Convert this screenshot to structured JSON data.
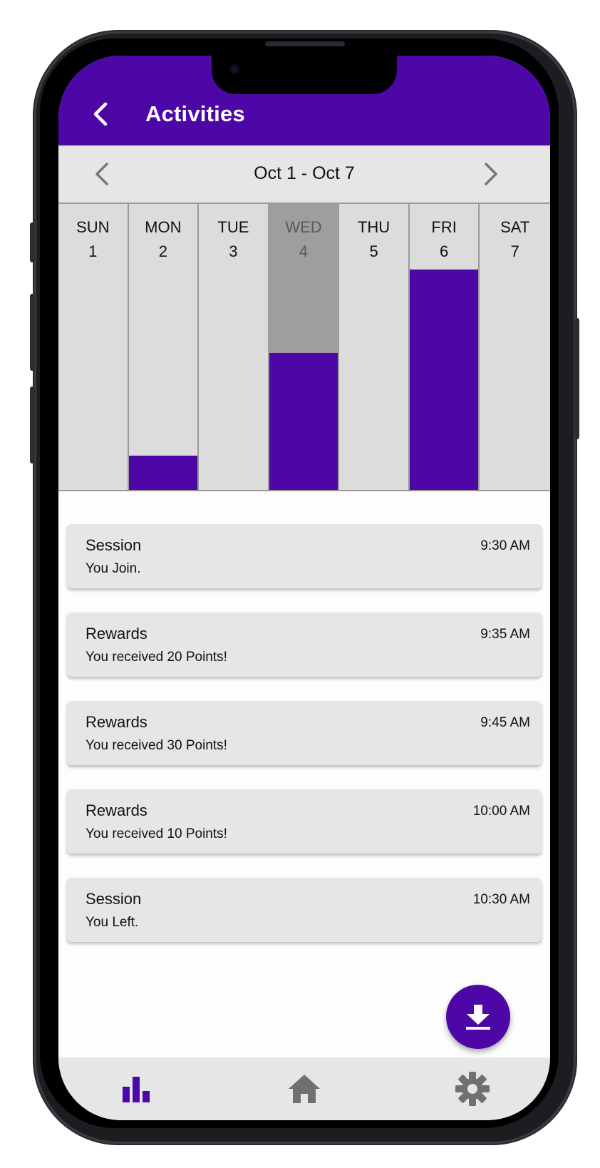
{
  "app_bar": {
    "title": "Activities",
    "back_icon": "chevron-left-icon",
    "color": "#4e07a7"
  },
  "week_nav": {
    "label": "Oct 1 - Oct 7",
    "prev_icon": "chevron-left-icon",
    "next_icon": "chevron-right-icon"
  },
  "chart_data": {
    "type": "bar",
    "categories": [
      "SUN 1",
      "MON 2",
      "TUE 3",
      "WED 4",
      "THU 5",
      "FRI 6",
      "SAT 7"
    ],
    "values": [
      0,
      0.12,
      0,
      0.48,
      0,
      0.77,
      0
    ],
    "selected": "WED 4",
    "bar_color": "#4e07a7"
  },
  "days": [
    {
      "name": "SUN",
      "num": "1",
      "level": 0,
      "selected": false
    },
    {
      "name": "MON",
      "num": "2",
      "level": 0.12,
      "selected": false
    },
    {
      "name": "TUE",
      "num": "3",
      "level": 0,
      "selected": false
    },
    {
      "name": "WED",
      "num": "4",
      "level": 0.48,
      "selected": true
    },
    {
      "name": "THU",
      "num": "5",
      "level": 0,
      "selected": false
    },
    {
      "name": "FRI",
      "num": "6",
      "level": 0.77,
      "selected": false
    },
    {
      "name": "SAT",
      "num": "7",
      "level": 0,
      "selected": false
    }
  ],
  "activities": [
    {
      "title": "Session",
      "time": "9:30 AM",
      "desc": "You Join."
    },
    {
      "title": "Rewards",
      "time": "9:35 AM",
      "desc": "You received 20 Points!"
    },
    {
      "title": "Rewards",
      "time": "9:45 AM",
      "desc": "You received 30 Points!"
    },
    {
      "title": "Rewards",
      "time": "10:00 AM",
      "desc": "You received 10 Points!"
    },
    {
      "title": "Session",
      "time": "10:30 AM",
      "desc": "You Left."
    }
  ],
  "fab": {
    "icon": "download-icon"
  },
  "bottom_nav": [
    {
      "icon": "bar-chart-icon",
      "active": true
    },
    {
      "icon": "home-icon",
      "active": false
    },
    {
      "icon": "settings-icon",
      "active": false
    }
  ]
}
